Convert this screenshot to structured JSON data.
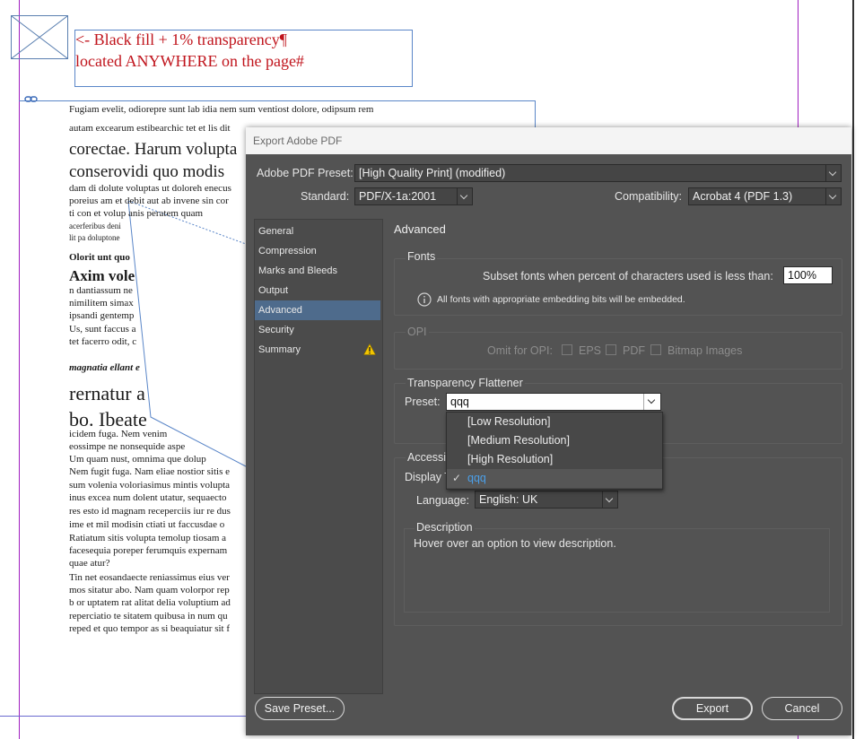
{
  "document": {
    "red_text_line1": "<- Black fill + 1% transparency¶",
    "red_text_line2": "located ANYWHERE on the page#",
    "body_lines": [
      "Fugiam evelit, odiorepre sunt lab idia nem sum ventiost dolore, odipsum rem",
      "autam excearum estibearchic tet et lis dit",
      "corectae. Harum volupta",
      "conserovidi quo modis",
      "dam di dolute voluptas ut doloreh enecus",
      "poreius am et debit aut ab invene sin cor",
      "ti con et volup anis peratem quam",
      "acerferibus deni",
      "lit pa doluptone",
      "Olorit unt quo",
      "Axim vole",
      "n dantiassum ne",
      "nimilitem simax",
      "ipsandi gentemp",
      "Us, sunt faccus a",
      "tet facerro odit, c",
      "magnatia ellant e",
      "rernatur a",
      "bo. Ibeate",
      "icidem fuga. Nem venim",
      "eossimpe ne nonsequide aspe",
      "Um quam nust, omnima que dolup",
      "Nem fugit fuga. Nam eliae nostior sitis e",
      "sum volenia voloriasimus mintis volupta",
      "inus excea num dolent utatur, sequaecto",
      "res esto id magnam receperciis iur re dus",
      "ime et mil modisin ctiati ut faccusdae o",
      "Ratiatum sitis volupta temolup tiosam a",
      "facesequia poreper ferumquis expernam",
      "quae atur?",
      "Tin net eosandaecte reniassimus eius ver",
      "mos sitatur abo. Nam quam volorpor rep",
      "b or uptatem rat alitat delia voluptium ad",
      "reperciatio te sitatem quibusa in num qu",
      "reped et quo tempor as si beaquiatur sit f"
    ]
  },
  "dialog": {
    "title": "Export Adobe PDF",
    "preset_label": "Adobe PDF Preset:",
    "preset_value": "[High Quality Print] (modified)",
    "standard_label": "Standard:",
    "standard_value": "PDF/X-1a:2001",
    "compat_label": "Compatibility:",
    "compat_value": "Acrobat 4 (PDF 1.3)",
    "sidebar": [
      "General",
      "Compression",
      "Marks and Bleeds",
      "Output",
      "Advanced",
      "Security",
      "Summary"
    ],
    "section_title": "Advanced",
    "fonts": {
      "label": "Fonts",
      "subset_label": "Subset fonts when percent of characters used is less than:",
      "subset_value": "100%",
      "info": "All fonts with appropriate embedding bits will be embedded."
    },
    "opi": {
      "label": "OPI",
      "omit_label": "Omit for OPI:",
      "eps": "EPS",
      "pdf": "PDF",
      "bitmap": "Bitmap Images"
    },
    "flattener": {
      "label": "Transparency Flattener",
      "preset_label": "Preset:",
      "preset_value": "qqq",
      "options": [
        "[Low Resolution]",
        "[Medium Resolution]",
        "[High Resolution]",
        "qqq"
      ],
      "check_glyph": "✓"
    },
    "accessibility": {
      "label": "Accessi",
      "display_label": "Display T",
      "language_label": "Language:",
      "language_value": "English: UK"
    },
    "description": {
      "label": "Description",
      "text": "Hover over an option to view description."
    },
    "buttons": {
      "save_preset": "Save Preset...",
      "export": "Export",
      "cancel": "Cancel"
    }
  }
}
